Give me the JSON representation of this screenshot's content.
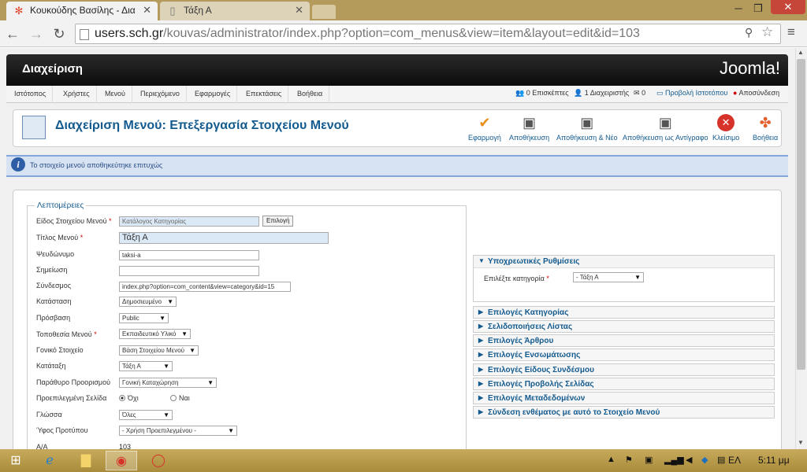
{
  "browser": {
    "tabs": [
      {
        "title": "Κουκούδης Βασίλης - Δια"
      },
      {
        "title": "Τάξη Α"
      }
    ],
    "url_host": "users.sch.gr",
    "url_path": "/kouvas/administrator/index.php?option=com_menus&view=item&layout=edit&id=103"
  },
  "header": {
    "title": "Διαχείριση",
    "logo": "Joomla!"
  },
  "menu": {
    "items": [
      "Ιστότοπος",
      "Χρήστες",
      "Μενού",
      "Περιεχόμενο",
      "Εφαρμογές",
      "Επεκτάσεις",
      "Βοήθεια"
    ],
    "status": {
      "visitors": "0 Επισκέπτες",
      "admins": "1 Διαχειριστής",
      "messages": "0",
      "view_site": "Προβολή Ιστοτόπου",
      "logout": "Αποσύνδεση"
    }
  },
  "toolbar": {
    "title": "Διαχείριση Μενού: Επεξεργασία Στοιχείου Μενού",
    "buttons": [
      "Εφαρμογή",
      "Αποθήκευση",
      "Αποθήκευση & Νέο",
      "Αποθήκευση ως Αντίγραφο",
      "Κλείσιμο",
      "Βοήθεια"
    ]
  },
  "message": "Το στοιχείο μενού αποθηκεύτηκε επιτυχώς",
  "details": {
    "legend": "Λεπτομέρειες",
    "menu_item_type": {
      "label": "Είδος Στοιχείου Μενού",
      "value": "Κατάλογος Κατηγορίας",
      "button": "Επιλογή"
    },
    "menu_title": {
      "label": "Τίτλος Μενού",
      "value": "Τάξη Α"
    },
    "alias": {
      "label": "Ψευδώνυμο",
      "value": "taksi-a"
    },
    "note": {
      "label": "Σημείωση",
      "value": ""
    },
    "link": {
      "label": "Σύνδεσμος",
      "value": "index.php?option=com_content&view=category&id=15"
    },
    "status": {
      "label": "Κατάσταση",
      "value": "Δημοσιευμένο"
    },
    "access": {
      "label": "Πρόσβαση",
      "value": "Public"
    },
    "menu_location": {
      "label": "Τοποθεσία Μενού",
      "value": "Εκπαιδευτικό Υλικό"
    },
    "parent": {
      "label": "Γονικό Στοιχείο",
      "value": "Βάση Στοιχείου Μενού"
    },
    "ordering": {
      "label": "Κατάταξη",
      "value": "Τάξη Α"
    },
    "target": {
      "label": "Παράθυρο Προορισμού",
      "value": "Γονική Καταχώρηση"
    },
    "default_page": {
      "label": "Προεπιλεγμένη Σελίδα",
      "no": "Όχι",
      "yes": "Ναι"
    },
    "language": {
      "label": "Γλώσσα",
      "value": "Όλες"
    },
    "template": {
      "label": "Ύφος Προτύπου",
      "value": "- Χρήση Προεπιλεγμένου -"
    },
    "id": {
      "label": "Α/Α",
      "value": "103"
    }
  },
  "options": {
    "required": {
      "title": "Υποχρεωτικές Ρυθμίσεις",
      "label": "Επιλέξτε κατηγορία",
      "value": "- Τάξη Α"
    },
    "panels": [
      "Επιλογές Κατηγορίας",
      "Σελιδοποιήσεις Λίστας",
      "Επιλογές Άρθρου",
      "Επιλογές Ενσωμάτωσης",
      "Επιλογές Είδους Συνδέσμου",
      "Επιλογές Προβολής Σελίδας",
      "Επιλογές Μεταδεδομένων",
      "Σύνδεση ενθέματος με αυτό το Στοιχείο Μενού"
    ]
  },
  "taskbar": {
    "language": "ΕΛ",
    "time": "5:11 μμ"
  }
}
